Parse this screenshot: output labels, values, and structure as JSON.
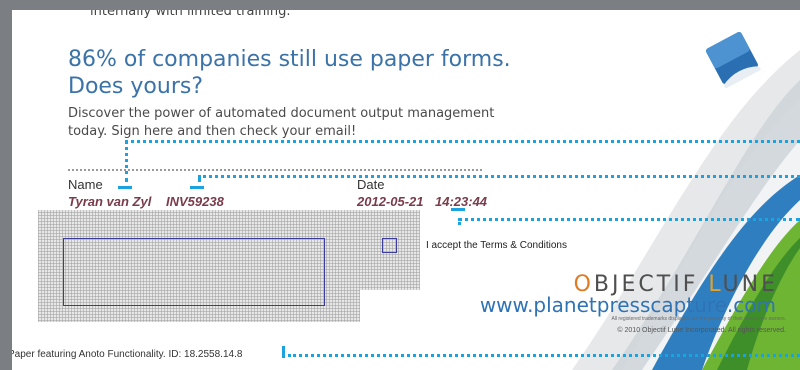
{
  "page": {
    "top_line": "internally with limited training.",
    "headline_line1": "86% of companies still use paper forms.",
    "headline_line2": "Does yours?",
    "intro_line1": "Discover the power of automated document output management",
    "intro_line2": "today. Sign here and then check your email!"
  },
  "form": {
    "name_label": "Name",
    "name_value": "Tyran van Zyl",
    "invoice_value": "INV59238",
    "date_label": "Date",
    "date_value": "2012-05-21",
    "time_value": "14:23:44",
    "checkbox_label": "I accept the Terms & Conditions",
    "checkbox_checked": false
  },
  "branding": {
    "brand_o": "O",
    "brand_objectif": "BJECTIF",
    "brand_l": "L",
    "brand_une": "UNE",
    "url": "www.planetpresscapture.com",
    "trademark": "All registered trademarks displayed are the property of their respective owners.",
    "copyright": "© 2010 Objectif Lune Incorporated.  All rights reserved."
  },
  "footer": {
    "text": "Paper featuring Anoto Functionality. ID: 18.2558.14.8"
  },
  "colors": {
    "headline": "#3b73a8",
    "value_text": "#7a3b4a",
    "accent_dots": "#1ba3e0",
    "swoosh_blue": "#2f7fc0",
    "swoosh_green": "#6fb534",
    "brand_orange": "#e07b22"
  }
}
